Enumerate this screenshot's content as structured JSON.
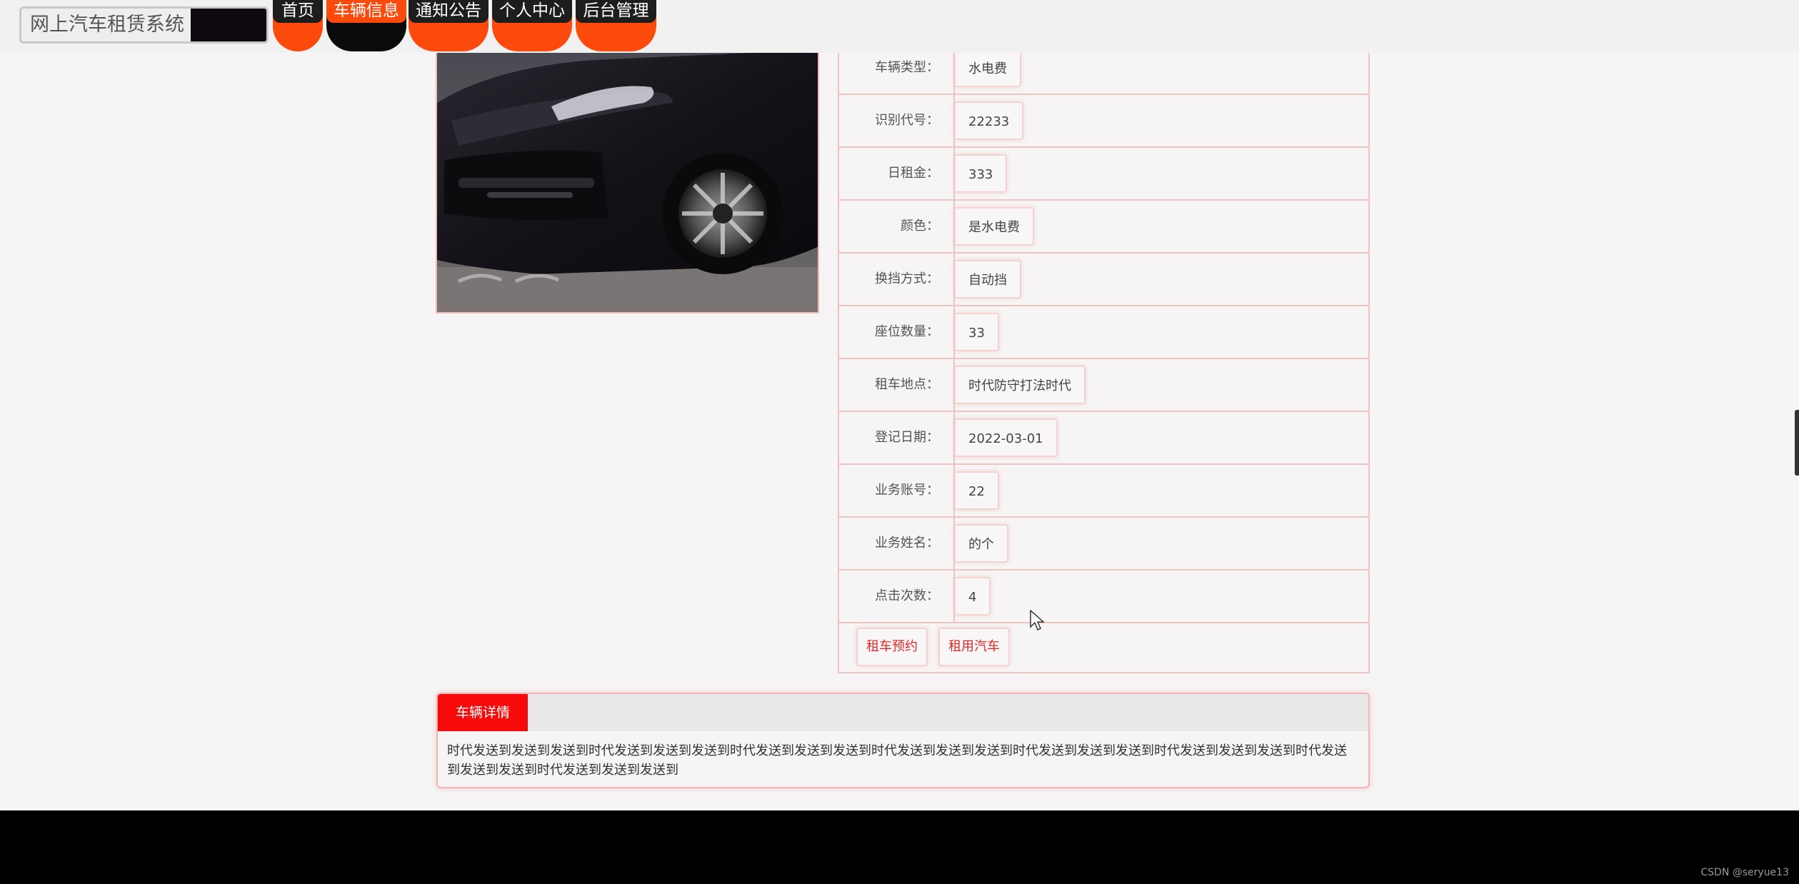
{
  "header": {
    "site_title": "网上汽车租赁系统",
    "nav": [
      {
        "label": "首页",
        "active": false
      },
      {
        "label": "车辆信息",
        "active": true
      },
      {
        "label": "通知公告",
        "active": false
      },
      {
        "label": "个人中心",
        "active": false
      },
      {
        "label": "后台管理",
        "active": false
      }
    ]
  },
  "car": {
    "fields": [
      {
        "label": "车辆类型：",
        "value": "水电费"
      },
      {
        "label": "识别代号：",
        "value": "22233"
      },
      {
        "label": "日租金：",
        "value": "333"
      },
      {
        "label": "颜色：",
        "value": "是水电费"
      },
      {
        "label": "换挡方式：",
        "value": "自动挡"
      },
      {
        "label": "座位数量：",
        "value": "33"
      },
      {
        "label": "租车地点：",
        "value": "时代防守打法时代"
      },
      {
        "label": "登记日期：",
        "value": "2022-03-01"
      },
      {
        "label": "业务账号：",
        "value": "22"
      },
      {
        "label": "业务姓名：",
        "value": "的个"
      },
      {
        "label": "点击次数：",
        "value": "4"
      }
    ],
    "actions": {
      "reserve_label": "租车预约",
      "rent_label": "租用汽车"
    }
  },
  "details": {
    "tab_label": "车辆详情",
    "content": "时代发送到发送到发送到时代发送到发送到发送到时代发送到发送到发送到时代发送到发送到发送到时代发送到发送到发送到时代发送到发送到发送到时代发送到发送到发送到时代发送到发送到发送到"
  },
  "footer": {
    "watermark": "CSDN @seryue13"
  },
  "colors": {
    "accent": "#fb4a0c",
    "red_tab": "#f80a0a",
    "dark": "#1d1d1d",
    "border_pink": "#f0c2c2"
  }
}
